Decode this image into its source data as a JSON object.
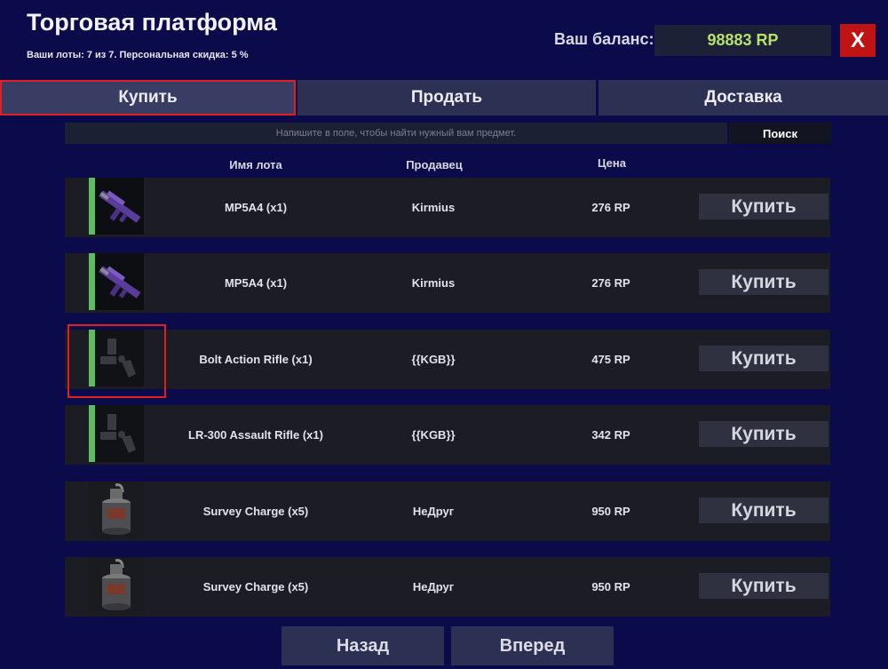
{
  "header": {
    "title": "Торговая платформа",
    "subtitle": "Ваши лоты: 7 из 7. Персональная скидка: 5 %",
    "balance_label": "Ваш баланс:",
    "balance_value": "98883 RP",
    "close_label": "X"
  },
  "tabs": [
    {
      "label": "Купить",
      "active": true
    },
    {
      "label": "Продать",
      "active": false
    },
    {
      "label": "Доставка",
      "active": false
    }
  ],
  "search": {
    "placeholder": "Напишите в поле, чтобы найти нужный вам предмет.",
    "button_label": "Поиск"
  },
  "columns": {
    "name": "Имя лота",
    "seller": "Продавец",
    "price": "Цена"
  },
  "rows": [
    {
      "name": "MP5A4 (x1)",
      "seller": "Kirmius",
      "price": "276 RP",
      "buy_label": "Купить",
      "icon": "smg-icon",
      "marker": "green"
    },
    {
      "name": "MP5A4 (x1)",
      "seller": "Kirmius",
      "price": "276 RP",
      "buy_label": "Купить",
      "icon": "smg-icon",
      "marker": "green"
    },
    {
      "name": "Bolt Action Rifle (x1)",
      "seller": "{{KGB}}",
      "price": "475 RP",
      "buy_label": "Купить",
      "icon": "rust-logo-icon",
      "marker": "green"
    },
    {
      "name": "LR-300 Assault Rifle (x1)",
      "seller": "{{KGB}}",
      "price": "342 RP",
      "buy_label": "Купить",
      "icon": "rust-logo-icon",
      "marker": "green"
    },
    {
      "name": "Survey Charge (x5)",
      "seller": "НеДруг",
      "price": "950 RP",
      "buy_label": "Купить",
      "icon": "survey-charge-icon",
      "marker": "none"
    },
    {
      "name": "Survey Charge (x5)",
      "seller": "НеДруг",
      "price": "950 RP",
      "buy_label": "Купить",
      "icon": "survey-charge-icon",
      "marker": "none"
    }
  ],
  "pagination": {
    "back_label": "Назад",
    "forward_label": "Вперед"
  },
  "colors": {
    "background": "#0b0a4a",
    "balance_text": "#b7e06b",
    "close_button": "#c01414",
    "marker_green": "#5dbb60",
    "highlight": "#e02020"
  }
}
